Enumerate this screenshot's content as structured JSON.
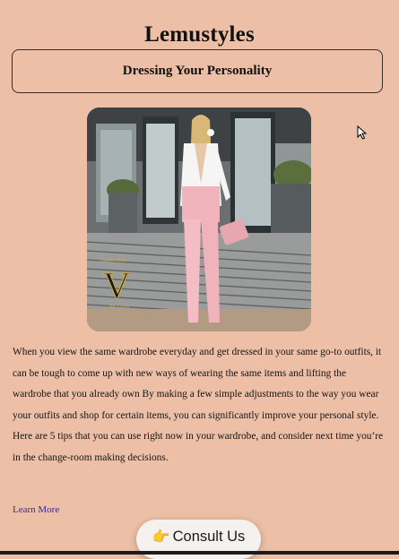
{
  "site": {
    "title": "Lemustyles"
  },
  "section": {
    "subtitle": "Dressing Your Personality"
  },
  "hero": {
    "description_icon": "fashion-photo",
    "watermark_brand": "V",
    "watermark_top": "Fashion Model",
    "watermark_bottom": "By Liron"
  },
  "article": {
    "body": "When you view the same wardrobe everyday and get dressed in your same go-to outfits, it can be tough to come up with new ways of wearing the same items and lifting the wardrobe that you already own By making a few simple adjustments to the way you wear your outfits and shop for certain items, you can significantly improve your personal style. Here are 5 tips that you can use right now in your wardrobe, and consider next time you’re in the change-room making decisions."
  },
  "links": {
    "learn_more": "Learn More"
  },
  "cta": {
    "icon": "pointing-hand-icon",
    "label": "Consult Us"
  },
  "colors": {
    "background": "#ecbfa6",
    "link": "#3e2a8c",
    "button_bg": "#f4f1ef"
  }
}
